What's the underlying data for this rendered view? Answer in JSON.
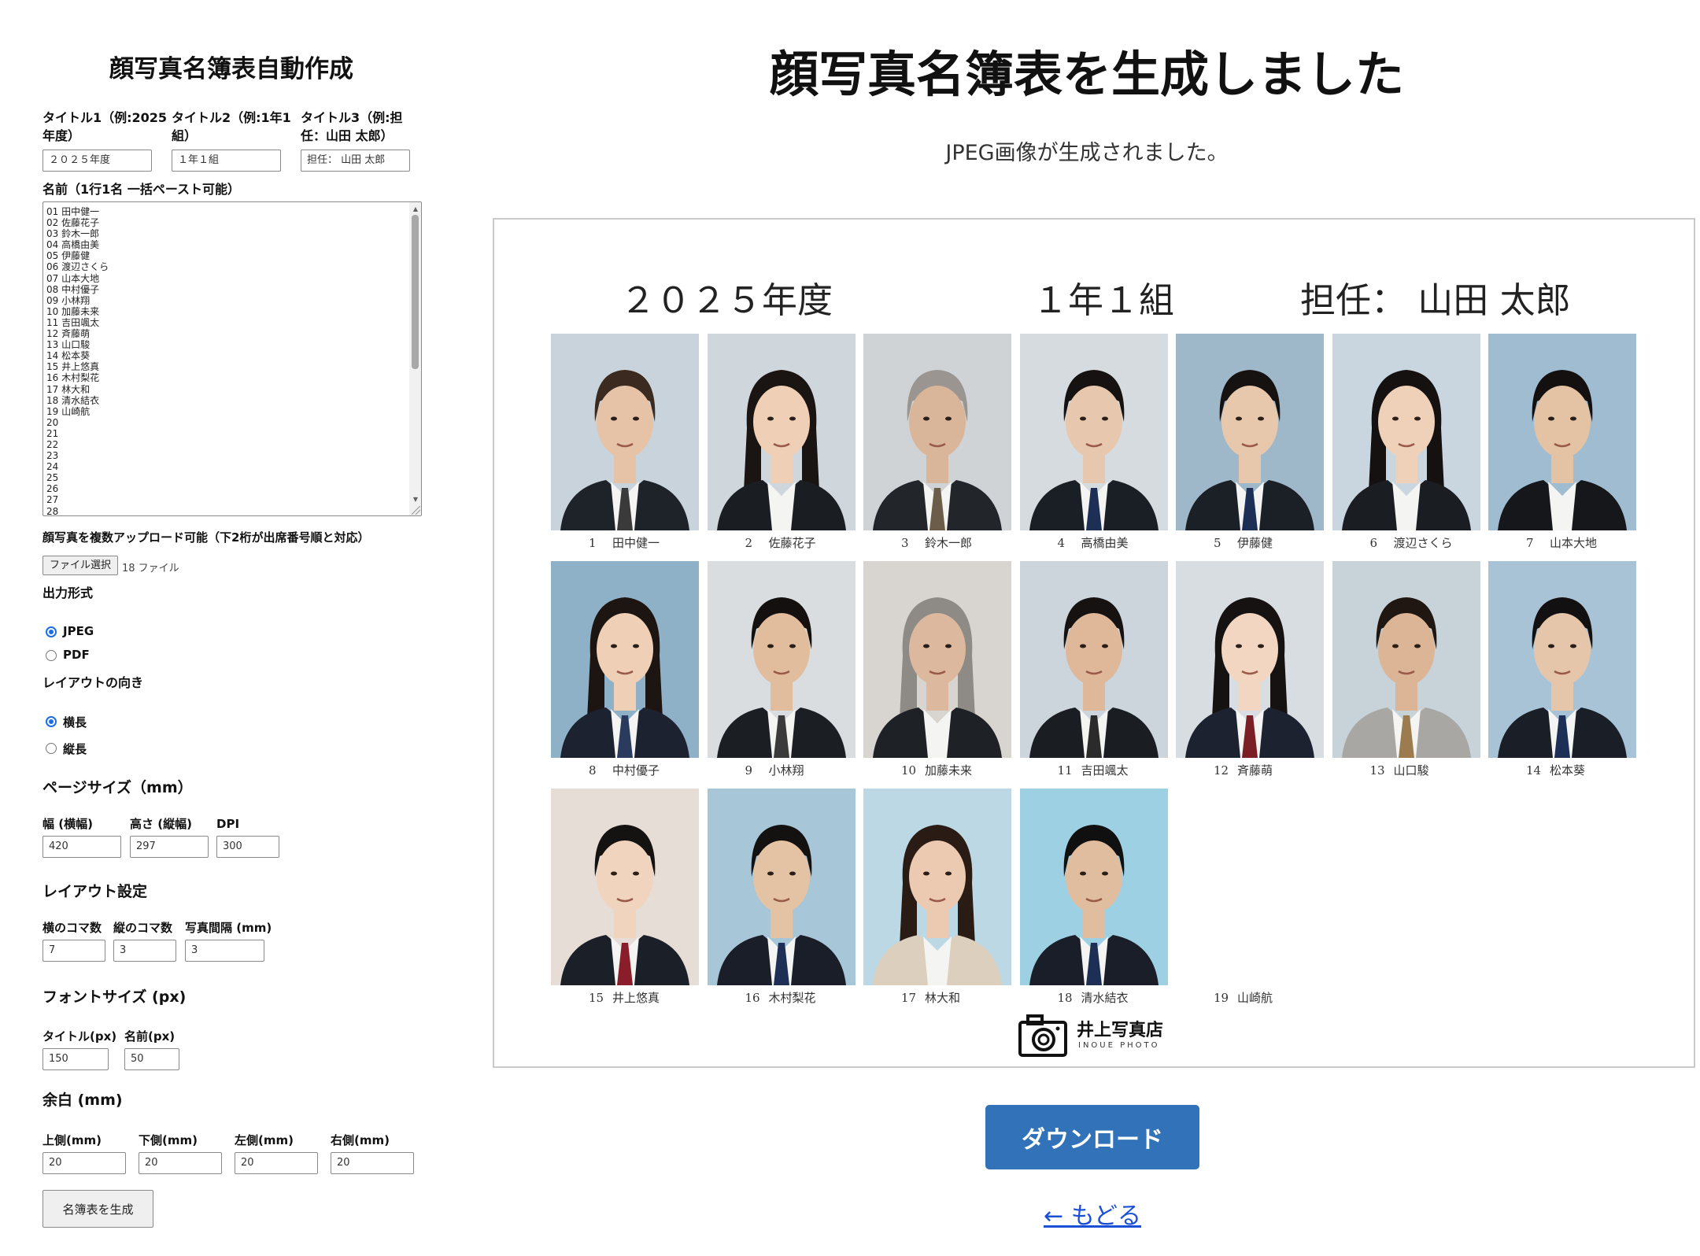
{
  "form": {
    "title": "顔写真名簿表自動作成",
    "title1_label_l1": "タイトル1（例:2025",
    "title1_label_l2": "年度）",
    "title2_label_l1": "タイトル2（例:1年1",
    "title2_label_l2": "組）",
    "title3_label_l1": "タイトル3（例:担",
    "title3_label_l2": "任：山田 太郎）",
    "title1_value": "２０２５年度",
    "title2_value": "１年１組",
    "title3_value": "担任： 山田 太郎",
    "names_label": "名前（1行1名 一括ペースト可能）",
    "names_lines": [
      "01 田中健一",
      "02 佐藤花子",
      "03 鈴木一郎",
      "04 高橋由美",
      "05 伊藤健",
      "06 渡辺さくら",
      "07 山本大地",
      "08 中村優子",
      "09 小林翔",
      "10 加藤未来",
      "11 吉田颯太",
      "12 斉藤萌",
      "13 山口駿",
      "14 松本葵",
      "15 井上悠真",
      "16 木村梨花",
      "17 林大和",
      "18 清水結衣",
      "19 山崎航",
      "20",
      "21",
      "22",
      "23",
      "24",
      "25",
      "26",
      "27",
      "28"
    ],
    "upload_label": "顔写真を複数アップロード可能（下2桁が出席番号順と対応）",
    "file_button": "ファイル選択",
    "file_count": "18 ファイル",
    "output_label": "出力形式",
    "output_jpeg": "JPEG",
    "output_pdf": "PDF",
    "output_selected": "JPEG",
    "orient_label": "レイアウトの向き",
    "orient_landscape": "横長",
    "orient_portrait": "縦長",
    "orient_selected": "横長",
    "page_size_section": "ページサイズ（mm）",
    "width_label": "幅 (横幅)",
    "height_label": "高さ (縦幅)",
    "dpi_label": "DPI",
    "width_value": "420",
    "height_value": "297",
    "dpi_value": "300",
    "layout_section": "レイアウト設定",
    "cols_label": "横のコマ数",
    "rows_label": "縦のコマ数",
    "gap_label": "写真間隔 (mm)",
    "cols_value": "7",
    "rows_value": "3",
    "gap_value": "3",
    "font_section": "フォントサイズ (px)",
    "title_px_label": "タイトル(px)",
    "name_px_label": "名前(px)",
    "title_px_value": "150",
    "name_px_value": "50",
    "margin_section": "余白 (mm)",
    "top_label": "上側(mm)",
    "bottom_label": "下側(mm)",
    "left_label": "左側(mm)",
    "right_label": "右側(mm)",
    "top_value": "20",
    "bottom_value": "20",
    "left_value": "20",
    "right_value": "20",
    "generate_button": "名簿表を生成"
  },
  "result": {
    "title": "顔写真名簿表を生成しました",
    "subtitle": "JPEG画像が生成されました。",
    "sheet_title1": "２０２５年度",
    "sheet_title2": "１年１組",
    "sheet_title3": "担任： 山田 太郎",
    "students": [
      {
        "num": "1",
        "name": "田中健一"
      },
      {
        "num": "2",
        "name": "佐藤花子"
      },
      {
        "num": "3",
        "name": "鈴木一郎"
      },
      {
        "num": "4",
        "name": "高橋由美"
      },
      {
        "num": "5",
        "name": "伊藤健"
      },
      {
        "num": "6",
        "name": "渡辺さくら"
      },
      {
        "num": "7",
        "name": "山本大地"
      },
      {
        "num": "8",
        "name": "中村優子"
      },
      {
        "num": "9",
        "name": "小林翔"
      },
      {
        "num": "10",
        "name": "加藤未来"
      },
      {
        "num": "11",
        "name": "吉田颯太"
      },
      {
        "num": "12",
        "name": "斉藤萌"
      },
      {
        "num": "13",
        "name": "山口駿"
      },
      {
        "num": "14",
        "name": "松本葵"
      },
      {
        "num": "15",
        "name": "井上悠真"
      },
      {
        "num": "16",
        "name": "木村梨花"
      },
      {
        "num": "17",
        "name": "林大和"
      },
      {
        "num": "18",
        "name": "清水結衣"
      },
      {
        "num": "19",
        "name": "山崎航"
      }
    ],
    "logo_text": "井上写真店",
    "logo_sub": "INOUE PHOTO",
    "download_button": "ダウンロード",
    "back_link": "← もどる"
  }
}
